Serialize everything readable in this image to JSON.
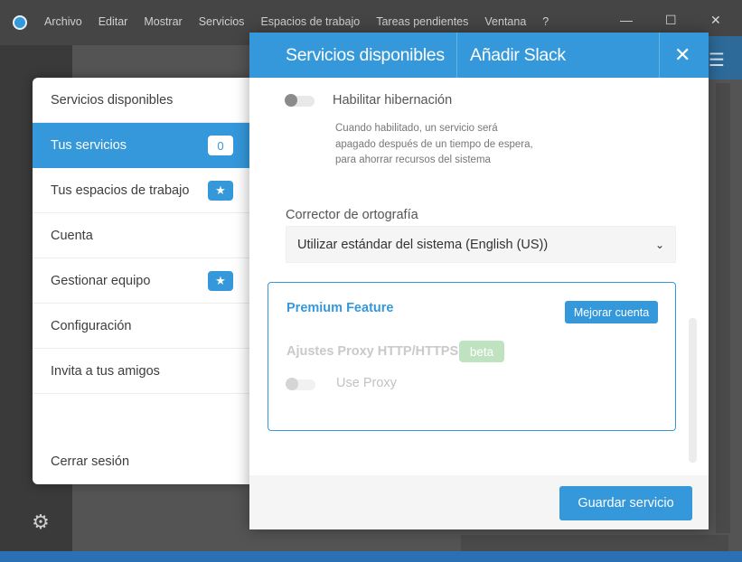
{
  "menubar": {
    "items": [
      "Archivo",
      "Editar",
      "Mostrar",
      "Servicios",
      "Espacios de trabajo",
      "Tareas pendientes",
      "Ventana",
      "?"
    ]
  },
  "window_controls": {
    "minimize": "—",
    "maximize": "☐",
    "close": "✕"
  },
  "settings_nav": {
    "items": [
      {
        "label": "Servicios disponibles",
        "active": false
      },
      {
        "label": "Tus servicios",
        "active": true,
        "badge": "0"
      },
      {
        "label": "Tus espacios de trabajo",
        "active": false,
        "badge_icon": "star-icon",
        "badge": "★"
      },
      {
        "label": "Cuenta",
        "active": false
      },
      {
        "label": "Gestionar equipo",
        "active": false,
        "badge_icon": "star-icon",
        "badge": "★"
      },
      {
        "label": "Configuración",
        "active": false
      },
      {
        "label": "Invita a tus amigos",
        "active": false
      }
    ],
    "logout_label": "Cerrar sesión"
  },
  "modal": {
    "title": "Servicios disponibles",
    "subtitle": "Añadir Slack",
    "close_glyph": "✕",
    "hibernation": {
      "label": "Habilitar hibernación",
      "enabled": false,
      "help": "Cuando habilitado, un servicio será apagado después de un tiempo de espera, para ahorrar recursos del sistema"
    },
    "spellcheck": {
      "label": "Corrector de ortografía",
      "selected": "Utilizar estándar del sistema (English (US))",
      "chevron": "⌄"
    },
    "premium": {
      "title": "Premium Feature",
      "upgrade_label": "Mejorar cuenta",
      "proxy_title": "Ajustes Proxy HTTP/HTTPS",
      "beta_label": "beta",
      "use_proxy_label": "Use Proxy",
      "use_proxy_enabled": false
    },
    "save_label": "Guardar servicio"
  },
  "colors": {
    "accent": "#3498db",
    "beta": "#bfe2c1",
    "titlebar": "#454545"
  },
  "icons": {
    "gear": "⚙",
    "hamburger": "☰"
  }
}
